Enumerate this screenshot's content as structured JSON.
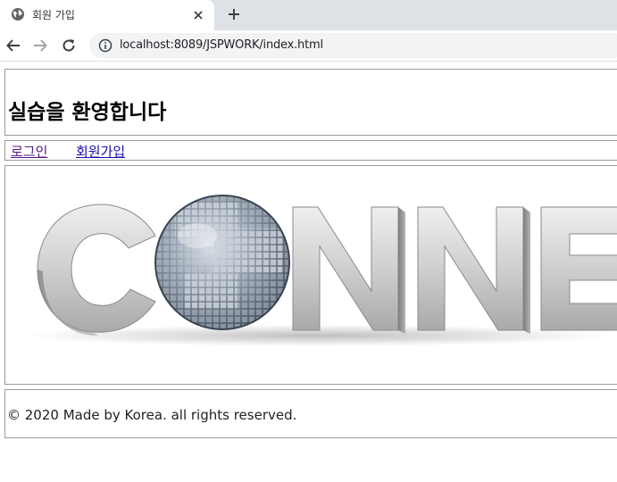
{
  "browser": {
    "tab_title": "회원 가입",
    "url": "localhost:8089/JSPWORK/index.html"
  },
  "page": {
    "title": "실습을 환영합니다",
    "nav": {
      "login": "로그인",
      "join": "회원가입"
    },
    "banner_word": "CONNE",
    "footer": "© 2020 Made by Korea. all rights reserved."
  },
  "colors": {
    "visited_link": "#551a8b",
    "link": "#1a0dab",
    "box_border": "#9a9a9a",
    "tabbar_bg": "#dee1e6"
  }
}
